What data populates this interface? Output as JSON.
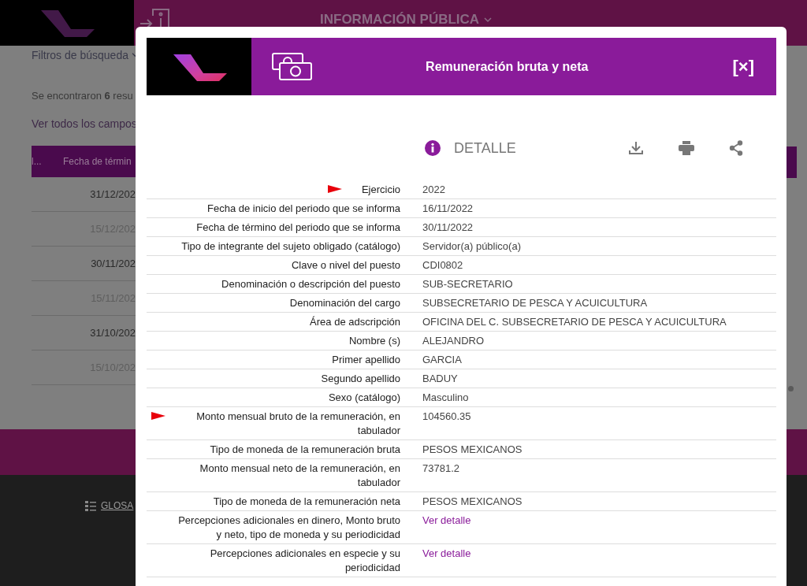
{
  "page": {
    "nav_title": "INFORMACIÓN PÚBLICA",
    "filters": "Filtros de búsqueda",
    "results": "Se encontraron **6** resu",
    "see_all": "Ver todos los campos",
    "table": {
      "columns": [
        "l...",
        "Fecha de términ"
      ],
      "rows": [
        {
          "date": "31/12/202",
          "muted": false
        },
        {
          "date": "15/12/202",
          "muted": true
        },
        {
          "date": "30/11/202",
          "muted": false
        },
        {
          "date": "15/11/202",
          "muted": true
        },
        {
          "date": "31/10/202",
          "muted": false
        },
        {
          "date": "15/10/202",
          "muted": true
        }
      ]
    },
    "footer_link": "GLOSA"
  },
  "modal": {
    "title": "Remuneración bruta y neta",
    "close": "[×]",
    "section": "DETALLE",
    "rows": [
      {
        "label": "Ejercicio",
        "value": "2022",
        "kind": "text",
        "marked": true
      },
      {
        "label": "Fecha de inicio del periodo que se informa",
        "value": "16/11/2022",
        "kind": "text",
        "marked": false
      },
      {
        "label": "Fecha de término del periodo que se informa",
        "value": "30/11/2022",
        "kind": "text",
        "marked": false
      },
      {
        "label": "Tipo de integrante del sujeto obligado (catálogo)",
        "value": "Servidor(a) público(a)",
        "kind": "text",
        "marked": false
      },
      {
        "label": "Clave o nivel del puesto",
        "value": "CDI0802",
        "kind": "text",
        "marked": false
      },
      {
        "label": "Denominación o descripción del puesto",
        "value": "SUB-SECRETARIO",
        "kind": "text",
        "marked": false
      },
      {
        "label": "Denominación del cargo",
        "value": "SUBSECRETARIO DE PESCA Y ACUICULTURA",
        "kind": "text",
        "marked": false
      },
      {
        "label": "Área de adscripción",
        "value": "OFICINA DEL C. SUBSECRETARIO DE PESCA Y ACUICULTURA",
        "kind": "text",
        "marked": false
      },
      {
        "label": "Nombre (s)",
        "value": "ALEJANDRO",
        "kind": "text",
        "marked": false
      },
      {
        "label": "Primer apellido",
        "value": "GARCIA",
        "kind": "text",
        "marked": false
      },
      {
        "label": "Segundo apellido",
        "value": "BADUY",
        "kind": "text",
        "marked": false
      },
      {
        "label": "Sexo (catálogo)",
        "value": "Masculino",
        "kind": "text",
        "marked": false
      },
      {
        "label": "Monto mensual bruto de la remuneración, en tabulador",
        "value": "104560.35",
        "kind": "text",
        "marked": true
      },
      {
        "label": "Tipo de moneda de la remuneración bruta",
        "value": "PESOS MEXICANOS",
        "kind": "text",
        "marked": false
      },
      {
        "label": "Monto mensual neto de la remuneración, en tabulador",
        "value": "73781.2",
        "kind": "text",
        "marked": false
      },
      {
        "label": "Tipo de moneda de la remuneración neta",
        "value": "PESOS MEXICANOS",
        "kind": "text",
        "marked": false
      },
      {
        "label": "Percepciones adicionales en dinero, Monto bruto y neto, tipo de moneda y su periodicidad",
        "value": "Ver detalle",
        "kind": "link",
        "marked": false
      },
      {
        "label": "Percepciones adicionales en especie y su periodicidad",
        "value": "Ver detalle",
        "kind": "link",
        "marked": false
      }
    ]
  }
}
